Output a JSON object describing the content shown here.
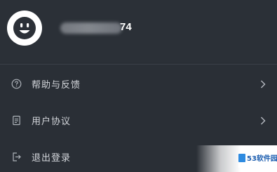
{
  "profile": {
    "avatar_icon": "smiley-avatar-icon",
    "username_visible_suffix": "74"
  },
  "menu": [
    {
      "label": "帮助与反馈",
      "icon": "help-circle-icon"
    },
    {
      "label": "用户协议",
      "icon": "document-icon"
    },
    {
      "label": "退出登录",
      "icon": "logout-icon"
    }
  ],
  "watermark": {
    "text": "53软件园"
  },
  "colors": {
    "background": "#2a2f36",
    "text": "#d4d7dc",
    "icon": "#aeb3ba"
  }
}
